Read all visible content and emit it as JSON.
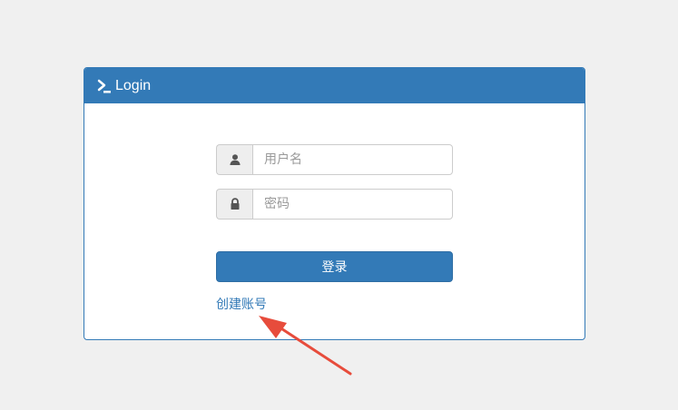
{
  "login_panel": {
    "title": "Login",
    "icon": "terminal-icon"
  },
  "form": {
    "username": {
      "icon": "user-icon",
      "placeholder": "用户名",
      "value": ""
    },
    "password": {
      "icon": "lock-icon",
      "placeholder": "密码",
      "value": ""
    },
    "submit_label": "登录",
    "create_account_label": "创建账号"
  },
  "annotation": {
    "icon": "red-arrow-icon",
    "color": "#e74c3c"
  },
  "colors": {
    "primary": "#337ab7",
    "background": "#f0f0f0"
  }
}
